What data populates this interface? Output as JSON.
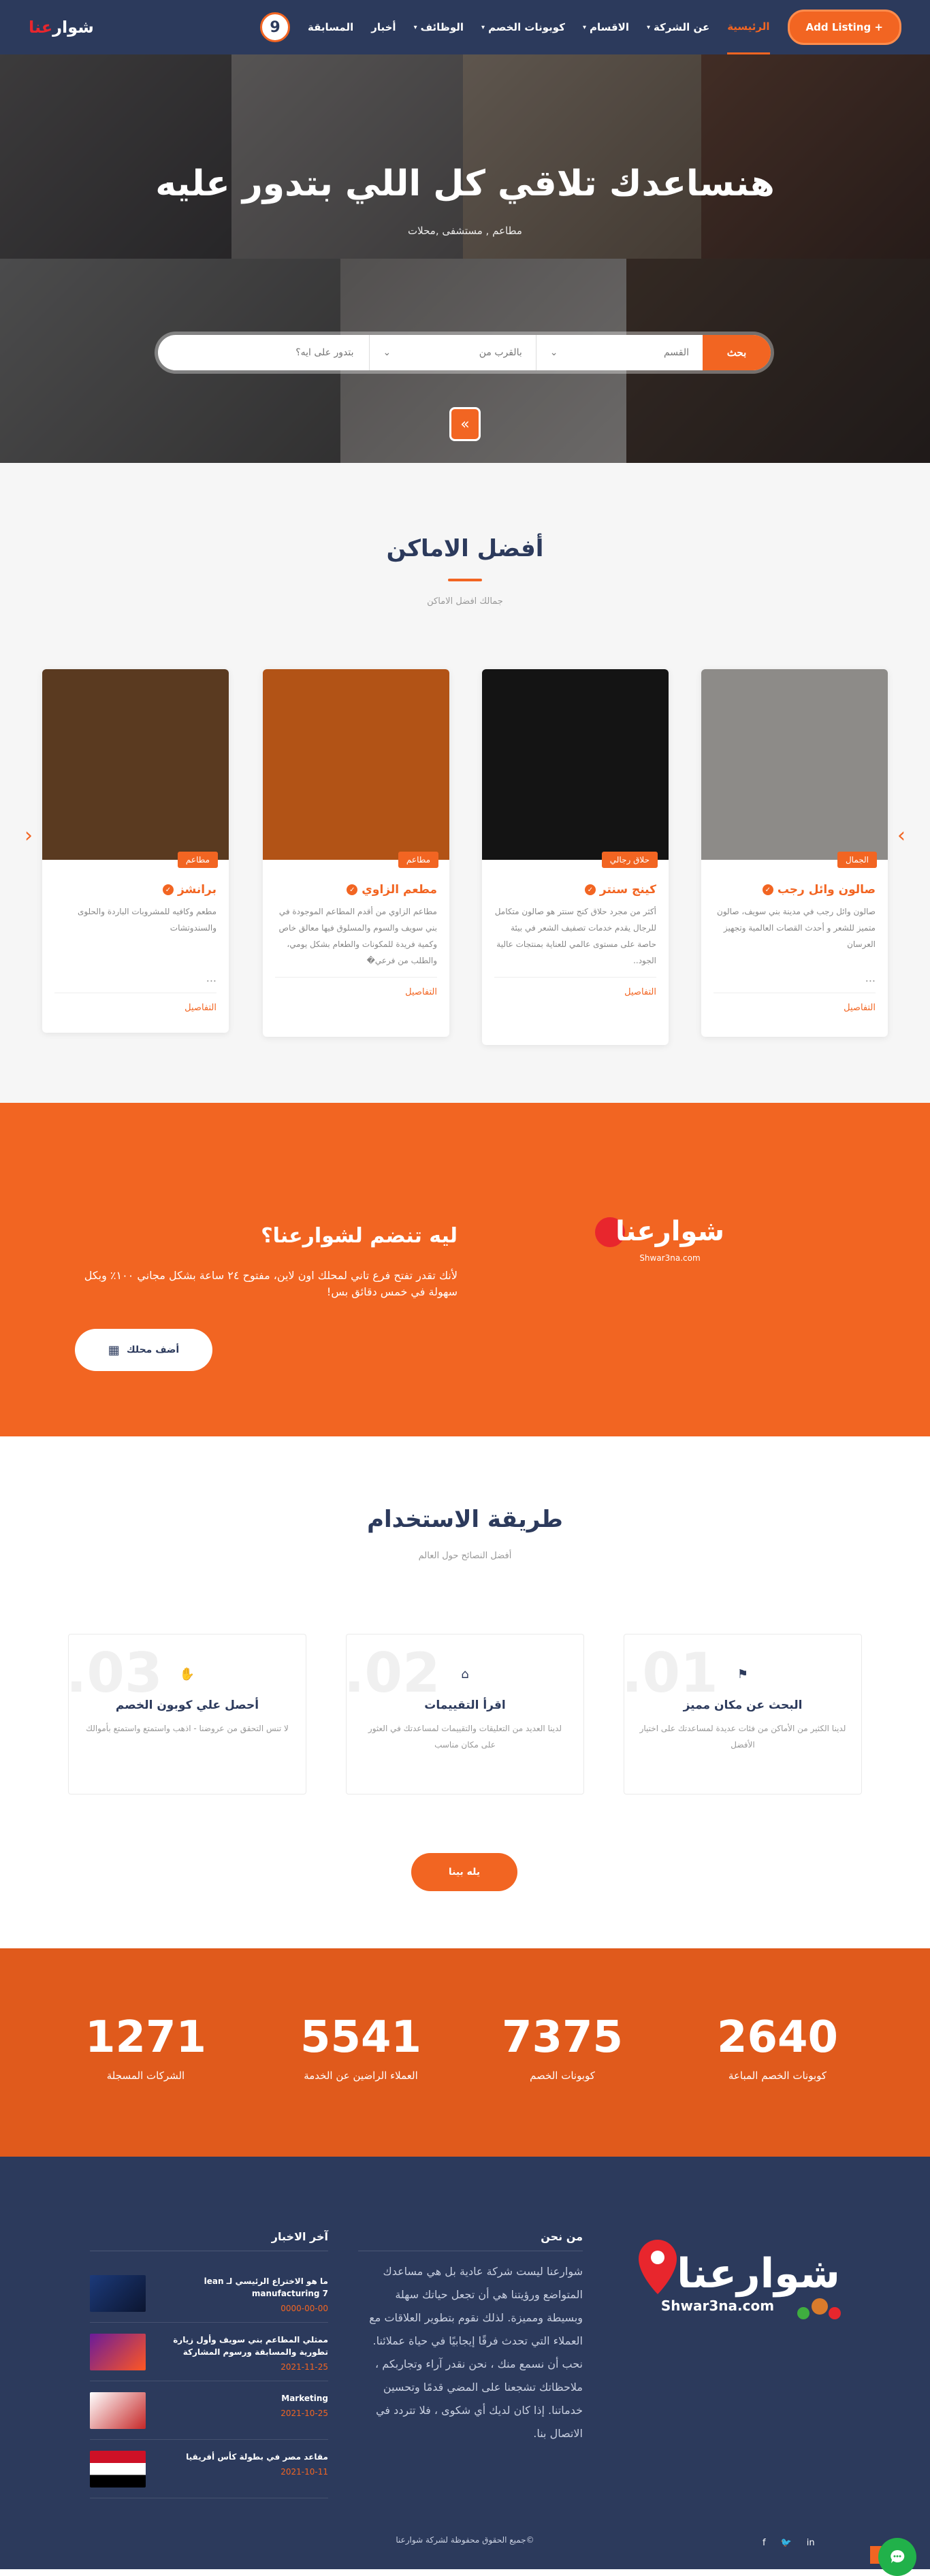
{
  "nav": {
    "logo_part1": "شوار",
    "logo_part2": "عنا",
    "badge": "9",
    "add_listing": "+ Add Listing",
    "items": [
      {
        "label": "الرئيسية",
        "caret": false,
        "active": true
      },
      {
        "label": "عن الشركة",
        "caret": true,
        "active": false
      },
      {
        "label": "الاقسام",
        "caret": true,
        "active": false
      },
      {
        "label": "كوبونات الخصم",
        "caret": true,
        "active": false
      },
      {
        "label": "الوظائف",
        "caret": true,
        "active": false
      },
      {
        "label": "أخبار",
        "caret": false,
        "active": false
      },
      {
        "label": "المسابقة",
        "caret": false,
        "active": false
      }
    ]
  },
  "hero": {
    "title": "هنساعدك تلاقي كل اللي بتدور عليه",
    "subtitle": "مطاعم , مستشفى ,محلات",
    "search_button": "بحث",
    "category_placeholder": "القسم",
    "nearby_placeholder": "بالقرب من",
    "query_placeholder": "بتدور على ايه؟",
    "scroll_icon": "double-chevron-down-icon"
  },
  "places": {
    "title": "أفضل الاماكن",
    "subtitle": "جمالك افضل الاماكن",
    "details_label": "التفاصيل",
    "cards": [
      {
        "name": "صالون وائل رجب",
        "category": "الجمال",
        "desc": "صالون وائل رجب في مدينة بني سويف، صالون متميز للشعر و أحدث القصات العالمية وتجهيز العرسان",
        "dots": "..."
      },
      {
        "name": "كينج سنتر",
        "category": "حلاق رجالي",
        "desc": "أكثر من مجرد حلاق \n\nكنج سنتر هو صالون متكامل للرجال يقدم خدمات تصفيف الشعر في بيئة حاصة على مستوى عالمي للعناية بمنتجات عالية الجود..",
        "dots": ""
      },
      {
        "name": "مطعم الزاوي",
        "category": "مطاعم",
        "desc": "مطاعم الزاوي من أقدم المطاعم الموجودة في بني سويف والسوم والمسلوق فيها معالق خاص وكمية فريدة للمكونات والطعام بشكل يومي، والطلب من فرعي�",
        "dots": ""
      },
      {
        "name": "برانشز",
        "category": "مطاعم",
        "desc": "مطعم وكافيه للمشروبات الباردة والحلوى والسندوتشات",
        "dots": "..."
      }
    ]
  },
  "join": {
    "title": "ليه تنضم لشوارعنا؟",
    "text": "لأنك تقدر تفتح فرع تاني لمحلك اون لاين، مفتوح ٢٤ ساعة بشكل مجاني ١٠٠٪ وبكل سهولة في خمس دقائق بس!",
    "button": "أضف محلك",
    "logo_text": "شوارعنا",
    "logo_sub": "Shwar3na.com"
  },
  "how": {
    "title": "طريقة الاستخدام",
    "subtitle": "أفضل النصائح حول العالم",
    "start_button": "يله بينا",
    "steps": [
      {
        "num": "01.",
        "icon": "location-icon",
        "title": "البحث عن مكان مميز",
        "text": "لدينا الكثير من الأماكن من فئات عديدة لمساعدتك على اختيار الأفضل"
      },
      {
        "num": "02.",
        "icon": "store-icon",
        "title": "اقرأ التقييمات",
        "text": "لدينا العديد من التعليقات والتقييمات لمساعدتك في العثور على مكان مناسب"
      },
      {
        "num": "03.",
        "icon": "hand-icon",
        "title": "أحصل علي كوبون الخصم",
        "text": "لا تنس التحقق من عروضنا - اذهب واستمتع واستمتع بأموالك"
      }
    ]
  },
  "stats": [
    {
      "value": "2640",
      "label": "كوبونات الخصم المباعة"
    },
    {
      "value": "7375",
      "label": "كوبونات الخصم"
    },
    {
      "value": "5541",
      "label": "العملاء الراضين عن الخدمة"
    },
    {
      "value": "1271",
      "label": "الشركات المسجلة"
    }
  ],
  "footer": {
    "about_title": "من نحن",
    "about_text": "شوارعنا ليست شركة عادية بل هي مساعدك المتواضع ورؤيتنا هي أن تجعل حياتك سهلة وبسيطة ومميزة. لذلك نقوم بتطوير العلاقات مع العملاء التي تحدث فرقًا إيجابيًا في حياة عملائنا. نحب أن نسمع منك ، نحن نقدر آراء وتجاربكم ، ملاحظاتك تشجعنا على المضي قدمًا وتحسين خدماتنا. إذا كان لديك أي شكوى ، فلا تتردد في الاتصال بنا.",
    "logo_text": "شوارعنا",
    "logo_sub": "Shwar3na.com",
    "news_title": "آخر الاخبار",
    "news": [
      {
        "title": "ما هو الاختراع الرئيسي لـ lean manufacturing 7",
        "date": "0000-00-00"
      },
      {
        "title": "ممثلي المطاعم بني سويف وأول زيارة تطورية والمسابقة ورسوم المشاركة",
        "date": "2021-11-25"
      },
      {
        "title": "Marketing",
        "date": "2021-10-25"
      },
      {
        "title": "مقاعد مصر في بطولة كأس أفريقيا",
        "date": "2021-10-11"
      }
    ],
    "copyright": "©جميع الحقوق محفوظة لشركة شوارعنا",
    "social": [
      "linkedin-icon",
      "twitter-icon",
      "facebook-icon"
    ]
  },
  "colors": {
    "primary": "#f26522",
    "navy": "#2c3a5c",
    "stats_bg": "#e05a1c"
  }
}
